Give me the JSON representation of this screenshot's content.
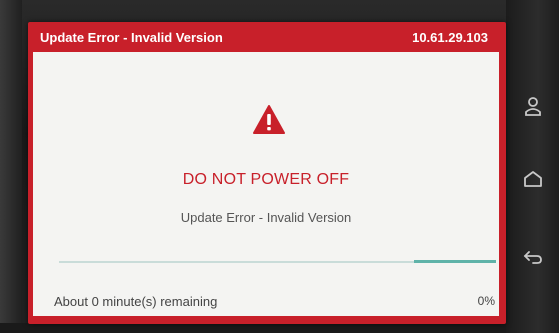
{
  "titlebar": {
    "title": "Update Error - Invalid Version",
    "ip_address": "10.61.29.103"
  },
  "dialog": {
    "icon": "warning-triangle-icon",
    "headline": "DO NOT POWER OFF",
    "message": "Update Error - Invalid Version"
  },
  "progress": {
    "remaining_text": "About 0 minute(s) remaining",
    "percent_text": "0%",
    "value_percent": 0
  },
  "side_nav": {
    "icons": [
      "user-icon",
      "home-icon",
      "back-icon"
    ]
  },
  "colors": {
    "frame_red": "#c8202a",
    "panel_bg": "#f4f4f2",
    "progress_accent": "#5fb3a9",
    "progress_track": "#c9dcd9"
  }
}
